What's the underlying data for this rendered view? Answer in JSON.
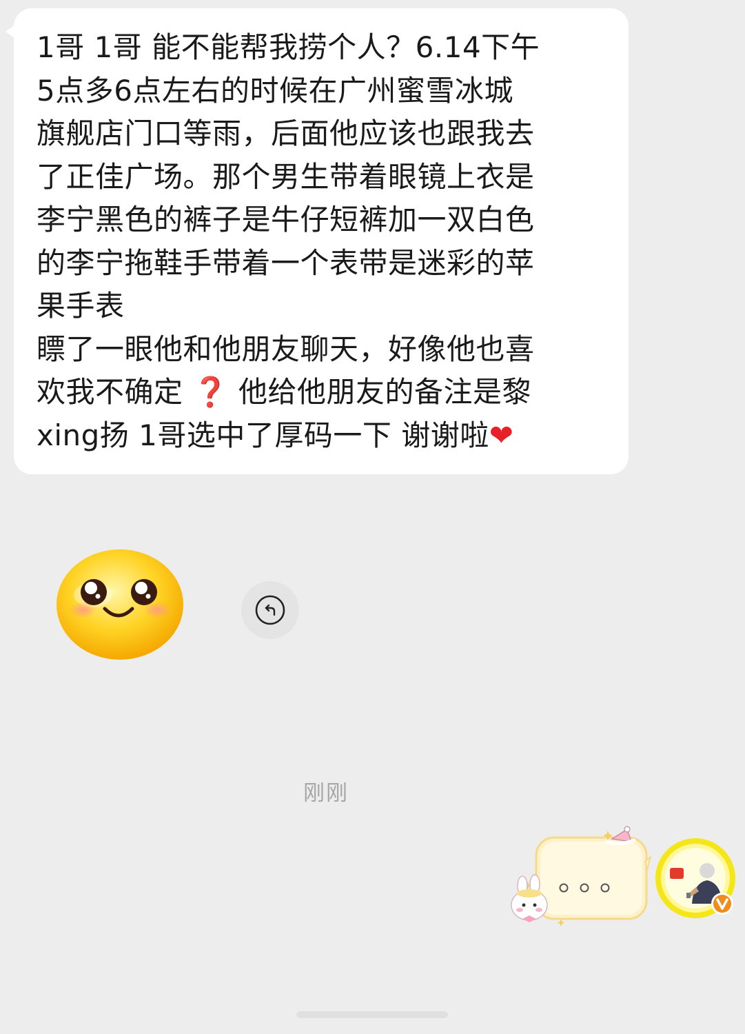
{
  "message": {
    "line1": "1哥 1哥 能不能帮我捞个人？6.14下午",
    "line2": "5点多6点左右的时候在广州蜜雪冰城",
    "line3": "旗舰店门口等雨，后面他应该也跟我去",
    "line4": "了正佳广场。那个男生带着眼镜上衣是",
    "line5": "李宁黑色的裤子是牛仔短裤加一双白色",
    "line6": "的李宁拖鞋手带着一个表带是迷彩的苹",
    "line7": "果手表",
    "line8": "瞟了一眼他和他朋友聊天，好像他也喜",
    "line9_a": "欢我不确定",
    "line9_emoji": "❓",
    "line9_b": "他给他朋友的备注是黎",
    "line10_a": "xing扬 1哥选中了厚码一下 谢谢啦",
    "line10_emoji": "❤"
  },
  "timestamp": "刚刚",
  "typing_bubble": {
    "dots": "· · ·"
  },
  "icons": {
    "reply": "reply-arrow-icon",
    "sticker": "smiley-face-sticker",
    "avatar": "user-avatar",
    "badge": "verified-v-badge"
  },
  "colors": {
    "background": "#ededed",
    "bubble": "#ffffff",
    "timestamp": "#a6a6a6",
    "heart": "#e8202a",
    "question": "#e8202a",
    "avatar_ring": "#f5e619",
    "badge": "#f08c1e"
  }
}
